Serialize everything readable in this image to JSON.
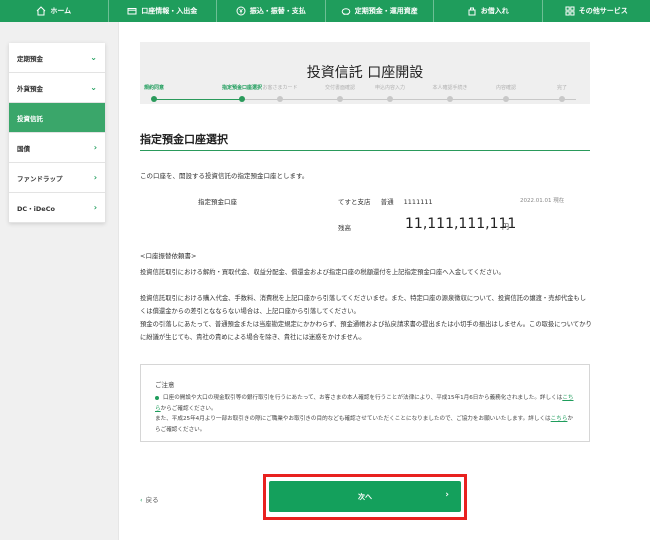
{
  "nav": [
    {
      "label": "ホーム",
      "icon": "home-icon"
    },
    {
      "label": "口座情報・入出金",
      "icon": "card-icon"
    },
    {
      "label": "振込・振替・支払",
      "icon": "yen-icon"
    },
    {
      "label": "定期預金・運用資産",
      "icon": "piggy-bank-icon"
    },
    {
      "label": "お借入れ",
      "icon": "loan-icon"
    },
    {
      "label": "その他サービス",
      "icon": "grid-icon"
    }
  ],
  "sidebar": {
    "items": [
      {
        "label": "定期預金",
        "chevron": "⌄"
      },
      {
        "label": "外貨預金",
        "chevron": "⌄"
      },
      {
        "label": "投資信託",
        "chevron": ""
      },
      {
        "label": "国債",
        "chevron": "›"
      },
      {
        "label": "ファンドラップ",
        "chevron": "›"
      },
      {
        "label": "DC・iDeCo",
        "chevron": "›"
      }
    ]
  },
  "page": {
    "title": "投資信託 口座開設",
    "steps": [
      "規約同意",
      "指定預金口座選択",
      "お客さまカード",
      "交付書面確認",
      "申込内容入力",
      "本人確認手続き",
      "内容確認",
      "完了"
    ]
  },
  "section": {
    "title": "指定預金口座選択",
    "intro": "この口座を、開設する投資信託の指定預金口座とします。"
  },
  "account": {
    "label": "指定預金口座",
    "branch": "てすと支店",
    "type": "普通",
    "number": "1111111",
    "as_of": "2022.01.01 現在",
    "balance_label": "残高",
    "balance": "11,111,111,111",
    "unit": "円"
  },
  "transfer": {
    "heading": "<口座振替依頼書>",
    "p1": "投資信託取引における解約・買取代金、収益分配金、償還金および指定口座の税額還付を上記指定預金口座へ入金してください。",
    "p2": "投資信託取引における購入代金、手数料、消費税を上記口座から引落してくださいませ。また、特定口座の源泉徴収について、投資信託の譲渡・売却代金もしくは償還金からの差引となならない場合は、上記口座から引落してください。",
    "p3": "預金の引落しにあたって、普通預金または当座勘定規定にかかわらず、預金通帳および払戻請求書の提出または小切手の振出はしません。この取扱についてかりに紛議が生じても、貴社の責めによる場合を除き、貴社には迷惑をかけません。"
  },
  "notice": {
    "title": "ご注意",
    "line1": "口座の開設や大口の現金取引等の銀行取引を行うにあたって、お客さまの本人確認を行うことが法律により、平成15年1月6日から義務化されました。詳しくは",
    "link1": "こちら",
    "line1_end": "からご確認ください。",
    "line2": "また、平成25年4月より一部お取引きの際にご職業やお取引きの目的なども確認させていただくことになりましたので、ご協力をお願いいたします。詳しくは",
    "link2": "こちら",
    "line2_end": "からご確認ください。"
  },
  "footer": {
    "back": "戻る",
    "next": "次へ"
  },
  "colors": {
    "brand": "#1f9d5c",
    "highlight": "#e8211f"
  }
}
